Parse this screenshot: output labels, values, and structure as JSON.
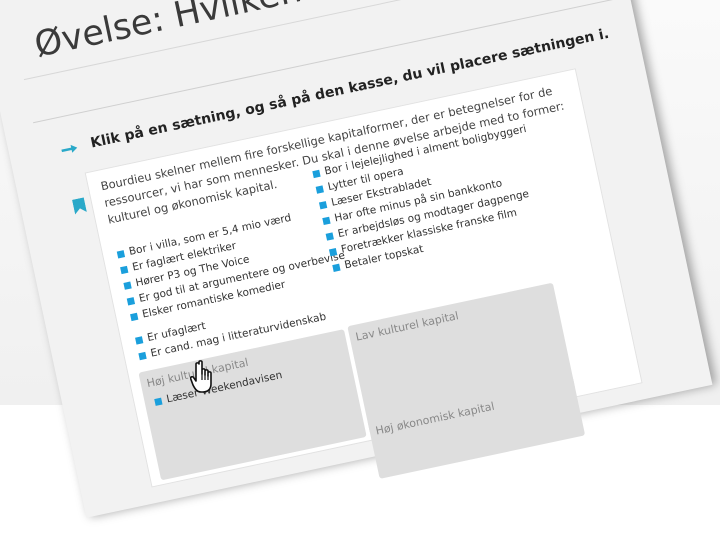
{
  "page": {
    "title": "Øvelse: Hvilken kapitalform",
    "subtitle": "Øvelse: Hvilken kapitalform? Tryk på sætningen, og så på den kasse, du vil placere sætningen i."
  },
  "instruction": "Klik på en sætning, og så på den kasse, du vil placere sætningen i.",
  "intro_text": "Bourdieu skelner mellem fire forskellige kapitalformer, der er betegnelser for de ressourcer, vi har som mennesker. Du skal i denne øvelse arbejde med to former: kulturel og økonomisk kapital.",
  "statements_left": [
    "Bor i villa, som er 5,4 mio værd",
    "Er faglært elektriker",
    "Hører P3 og The Voice",
    "Er god til at argumentere og overbevise",
    "Elsker romantiske komedier"
  ],
  "statements_left2": [
    "Er ufaglært",
    "Er cand. mag i litteraturvidenskab"
  ],
  "statements_right": [
    "Bor i lejelejlighed i alment boligbyggeri",
    "Lytter til opera",
    "Læser Ekstrabladet",
    "Har ofte minus på sin bankkonto",
    "Er arbejdsløs og modtager dagpenge",
    "Foretrækker klassiske franske film",
    "Betaler topskat"
  ],
  "boxes": {
    "high_cultural": {
      "label": "Høj kulturel kapital",
      "items": [
        "Læser Weekendavisen"
      ]
    },
    "low_cultural": {
      "label": "Lav kulturel kapital",
      "items": []
    },
    "economic": {
      "label": "Høj økonomisk kapital",
      "items": []
    }
  },
  "colors": {
    "accent": "#1a9fdc",
    "box_bg": "#dedede"
  }
}
